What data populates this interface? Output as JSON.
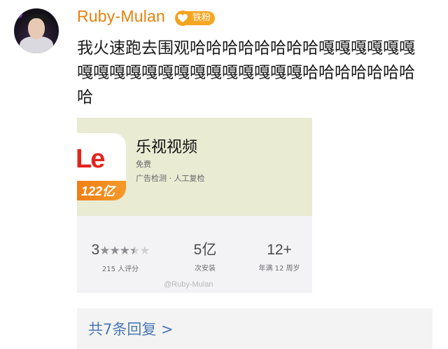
{
  "post": {
    "username": "Ruby-Mulan",
    "badge_label": "铁粉",
    "text": "我火速跑去围观哈哈哈哈哈哈哈哈嘎嘎嘎嘎嘎嘎嘎嘎嘎嘎嘎嘎嘎嘎嘎嘎嘎嘎嘎嘎哈哈哈哈哈哈哈哈"
  },
  "screenshot": {
    "icon_logo_text": "Le",
    "icon_banner_text": "122亿",
    "app_name": "乐视视频",
    "price": "免费",
    "ad_check": "广告检测 · 人工复检",
    "rating_value": "3",
    "rating_stars": 3.5,
    "rating_count": "215 人评分",
    "installs": "5亿",
    "installs_label": "次安装",
    "age": "12+",
    "age_label": "年满 12 周岁",
    "watermark": "@Ruby-Mulan"
  },
  "replies": {
    "label": "共7条回复 >"
  },
  "colors": {
    "username": "#e8810b",
    "badge": "#f5a623",
    "link": "#4a78b4"
  }
}
